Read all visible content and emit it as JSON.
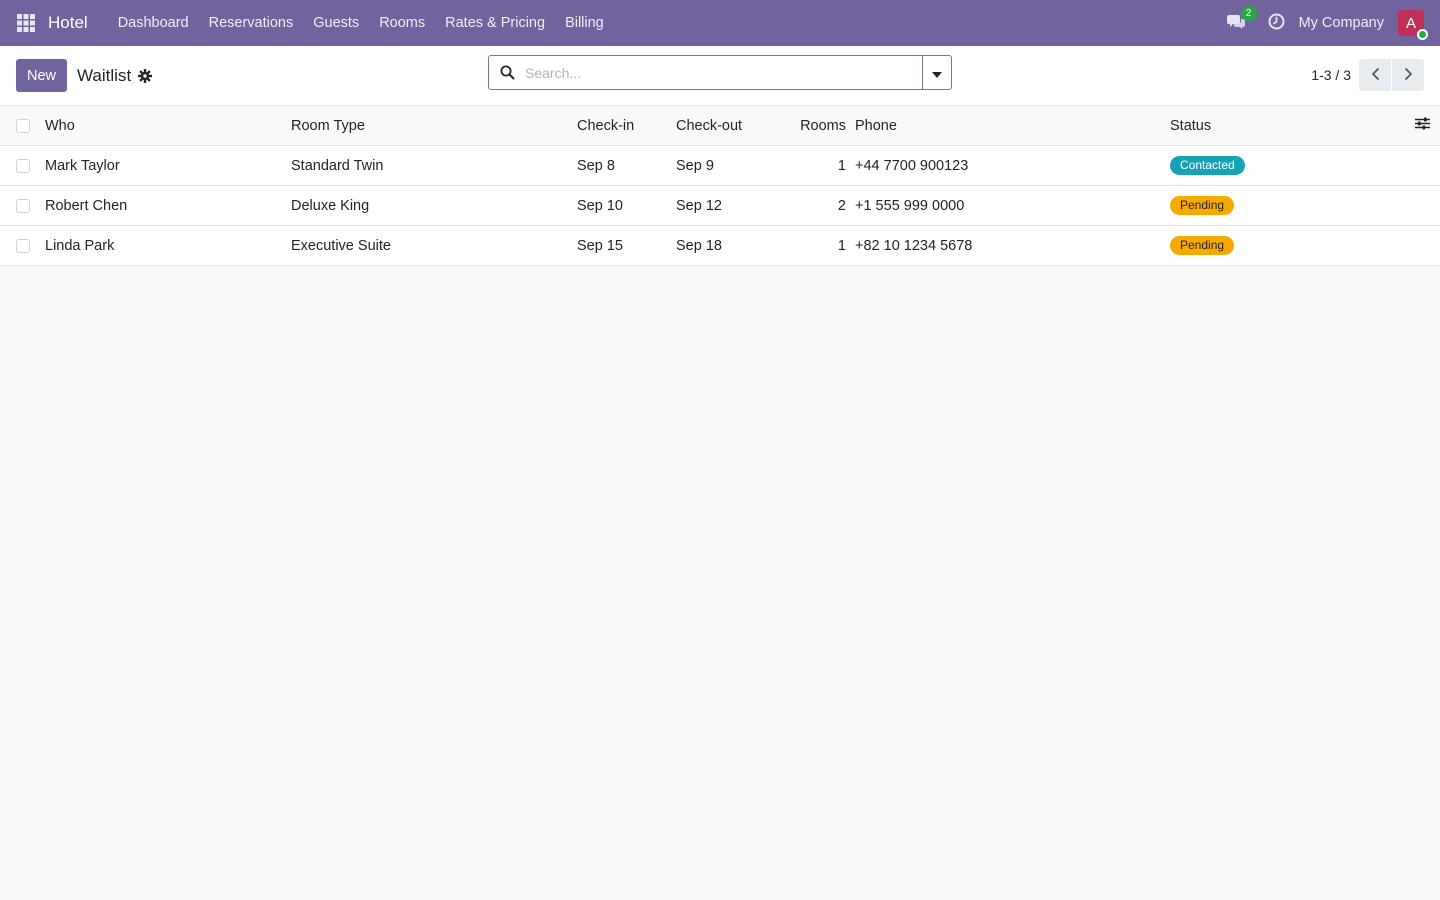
{
  "navbar": {
    "brand": "Hotel",
    "menu": [
      "Dashboard",
      "Reservations",
      "Guests",
      "Rooms",
      "Rates & Pricing",
      "Billing"
    ],
    "chat_count": "2",
    "company": "My Company",
    "avatar_letter": "A",
    "accent_color": "#71639e"
  },
  "control": {
    "new_label": "New",
    "title": "Waitlist",
    "search_placeholder": "Search...",
    "pager": "1-3 / 3"
  },
  "table": {
    "headers": {
      "who": "Who",
      "room_type": "Room Type",
      "check_in": "Check-in",
      "check_out": "Check-out",
      "rooms": "Rooms",
      "phone": "Phone",
      "status": "Status"
    },
    "rows": [
      {
        "who": "Mark Taylor",
        "room_type": "Standard Twin",
        "check_in": "Sep 8",
        "check_out": "Sep 9",
        "rooms": "1",
        "phone": "+44 7700 900123",
        "status": "Contacted",
        "status_color": "#17a2b8"
      },
      {
        "who": "Robert Chen",
        "room_type": "Deluxe King",
        "check_in": "Sep 10",
        "check_out": "Sep 12",
        "rooms": "2",
        "phone": "+1 555 999 0000",
        "status": "Pending",
        "status_color": "#f7a900"
      },
      {
        "who": "Linda Park",
        "room_type": "Executive Suite",
        "check_in": "Sep 15",
        "check_out": "Sep 18",
        "rooms": "1",
        "phone": "+82 10 1234 5678",
        "status": "Pending",
        "status_color": "#f7a900"
      }
    ]
  }
}
